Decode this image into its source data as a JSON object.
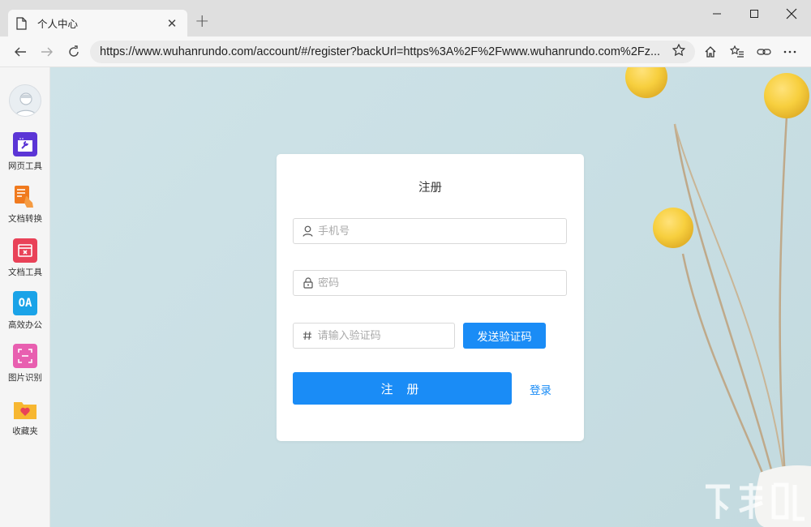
{
  "browser": {
    "tab_title": "个人中心",
    "url": "https://www.wuhanrundo.com/account/#/register?backUrl=https%3A%2F%2Fwww.wuhanrundo.com%2Fz..."
  },
  "sidebar": {
    "items": [
      {
        "label": "网页工具",
        "icon": "web-tools-icon",
        "color": "#5b35d6"
      },
      {
        "label": "文档转换",
        "icon": "doc-convert-icon",
        "color": "#f07a1e"
      },
      {
        "label": "文档工具",
        "icon": "doc-tools-icon",
        "color": "#e94258"
      },
      {
        "label": "高效办公",
        "icon": "office-icon",
        "color": "#1aa3e8",
        "glyph": "OA"
      },
      {
        "label": "图片识别",
        "icon": "image-recognition-icon",
        "color": "#e85fb0"
      },
      {
        "label": "收藏夹",
        "icon": "favorites-icon",
        "color": "#f7b731"
      }
    ]
  },
  "form": {
    "title": "注册",
    "phone_placeholder": "手机号",
    "password_placeholder": "密码",
    "code_placeholder": "请输入验证码",
    "send_code_label": "发送验证码",
    "register_label": "注 册",
    "login_link": "登录"
  },
  "colors": {
    "primary": "#1a8cf6",
    "background": "#cbe0e5"
  }
}
